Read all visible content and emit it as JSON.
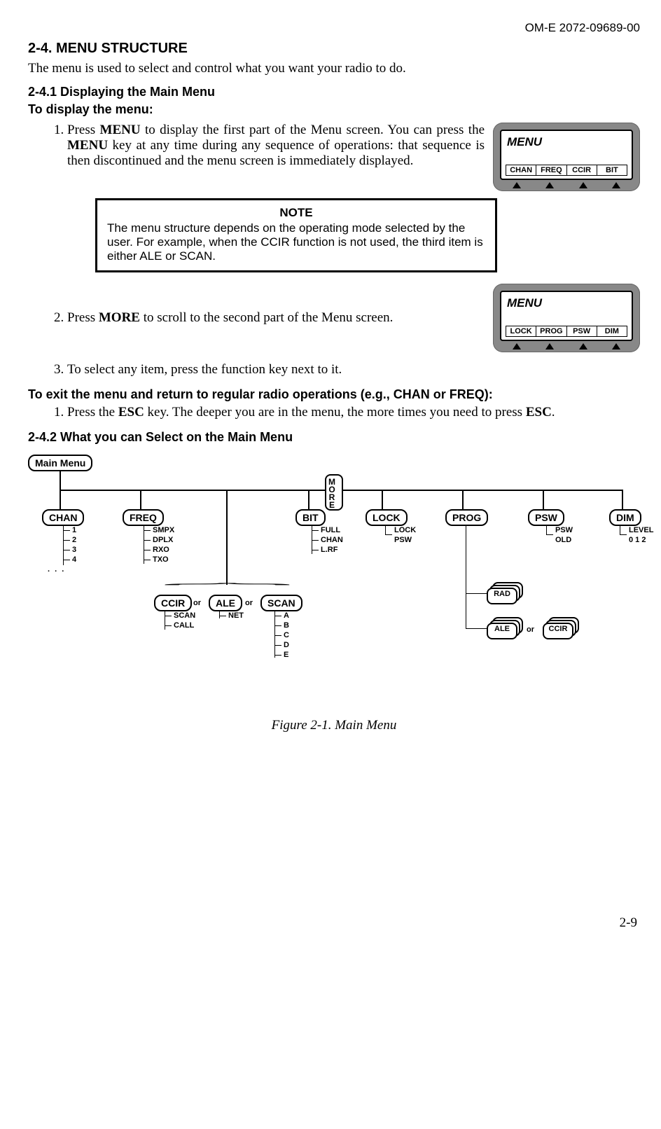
{
  "doc_id": "OM-E 2072-09689-00",
  "page_num": "2-9",
  "heading_24": "2-4.     MENU STRUCTURE",
  "intro": "The menu is used to select and control what you want your radio to do.",
  "heading_241": "2-4.1     Displaying the Main Menu",
  "to_display": "To display the menu:",
  "step1_a": "Press  ",
  "step1_menu": "MENU",
  "step1_b": "  to  display  the  first  part  of  the  Menu  screen. You  can  press  the  ",
  "step1_c": " key  at  any  time  during  any  sequence  of operations: that sequence is then discontinued and the menu screen is immediately displayed.",
  "lcd_title": "MENU",
  "lcd1": {
    "k1": "CHAN",
    "k2": "FREQ",
    "k3": "CCIR",
    "k4": "BIT"
  },
  "note_title": "NOTE",
  "note_body": "The menu structure depends on the operating mode selected by the user. For example, when the CCIR function is not used, the third item is either ALE or SCAN.",
  "step2_a": "Press ",
  "step2_more": "MORE",
  "step2_b": " to scroll to the second part of the Menu screen.",
  "lcd2": {
    "k1": "LOCK",
    "k2": "PROG",
    "k3": "PSW",
    "k4": "DIM"
  },
  "step3": "To select any item, press the function key next to it.",
  "exit_heading": "To exit the menu and return to regular radio operations (e.g., CHAN or FREQ):",
  "exit_step_a": "Press the ",
  "exit_esc": "ESC",
  "exit_step_b": " key. The deeper you are in the menu, the more times you need to press ",
  "exit_step_c": ".",
  "heading_242": "2-4.2     What you can Select on the Main Menu",
  "fig_caption": "Figure 2-1. Main Menu",
  "diagram": {
    "root": "Main Menu",
    "more": "MORE",
    "chan": "CHAN",
    "chan_items": [
      "1",
      "2",
      "3",
      "4"
    ],
    "freq": "FREQ",
    "freq_items": [
      "SMPX",
      "DPLX",
      "RXO",
      "TXO"
    ],
    "bit": "BIT",
    "bit_items": [
      "FULL",
      "CHAN",
      "L.RF"
    ],
    "lock": "LOCK",
    "lock_items": [
      "LOCK",
      "PSW"
    ],
    "prog": "PROG",
    "psw": "PSW",
    "psw_items": [
      "PSW",
      "OLD"
    ],
    "dim": "DIM",
    "dim_items": [
      "LEVEL",
      "0 1 2"
    ],
    "ccir": "CCIR",
    "ccir_items": [
      "SCAN",
      "CALL"
    ],
    "ale": "ALE",
    "ale_items": [
      "NET"
    ],
    "scan": "SCAN",
    "scan_items": [
      "A",
      "B",
      "C",
      "D",
      "E"
    ],
    "rad": "RAD",
    "prog_ale": "ALE",
    "prog_ccir": "CCIR",
    "or": "or"
  }
}
